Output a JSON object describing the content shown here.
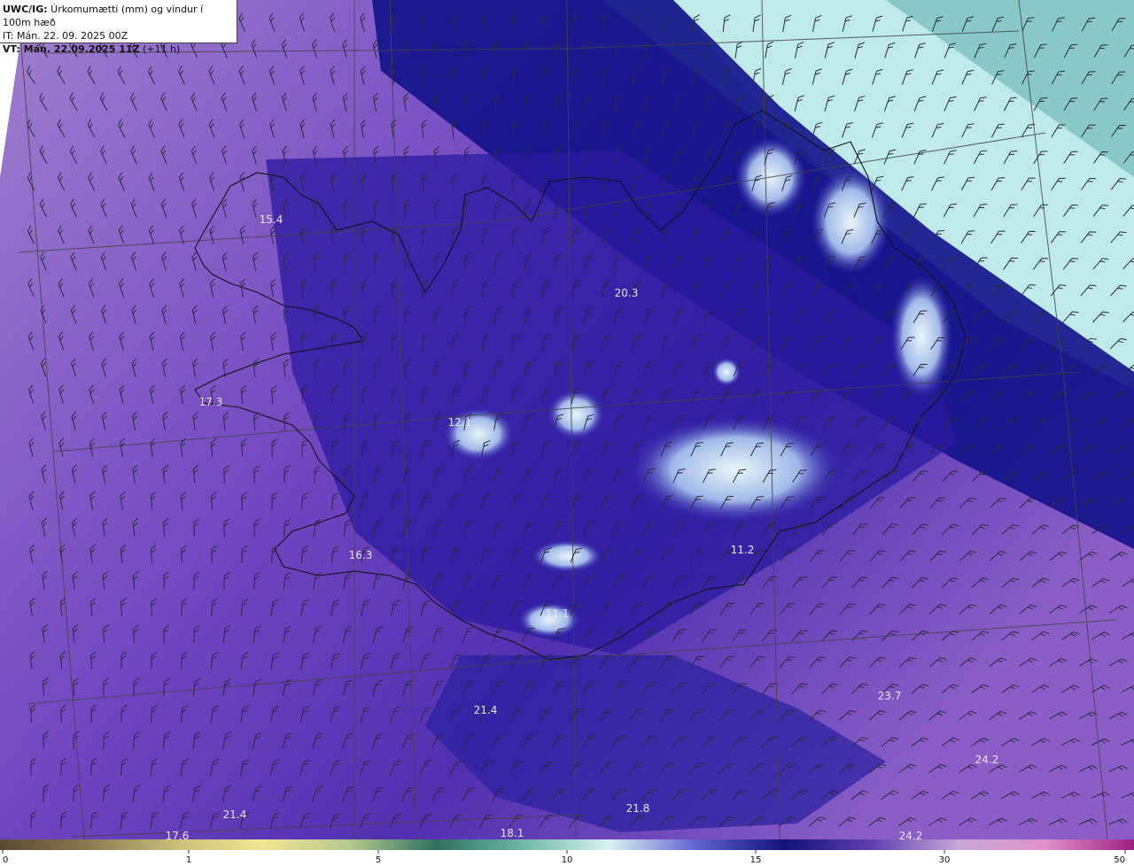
{
  "header": {
    "line1_bold": "UWC/IG:",
    "line1_rest": " Úrkomumætti (mm) og vindur í 100m hæð",
    "line2": "IT: Mán. 22. 09. 2025 00Z",
    "line3_bold": "VT: Mán. 22.09.2025 11Z",
    "line3_rest": " (+11 h)"
  },
  "map_labels": [
    {
      "text": "15.4"
    },
    {
      "text": "20.3"
    },
    {
      "text": "17.3"
    },
    {
      "text": "12.1"
    },
    {
      "text": "16.3"
    },
    {
      "text": "11.2"
    },
    {
      "text": "11.1"
    },
    {
      "text": "21.4"
    },
    {
      "text": "23.7"
    },
    {
      "text": "24.2"
    },
    {
      "text": "21.4"
    },
    {
      "text": "21.8"
    },
    {
      "text": "18.1"
    },
    {
      "text": "17.6"
    },
    {
      "text": "24.2"
    }
  ],
  "colorbar": {
    "ticks": [
      "0",
      "1",
      "5",
      "10",
      "15",
      "30",
      "50"
    ],
    "colors": [
      "#5a4a32",
      "#8a7a50",
      "#c8be78",
      "#f2e690",
      "#b4c890",
      "#2e7060",
      "#70b8a8",
      "#d8f2f2",
      "#6060d0",
      "#12127a",
      "#6040b0",
      "#c8a8d8",
      "#e090c8",
      "#a02080"
    ]
  },
  "colors": {
    "land_outline": "#111111",
    "grid": "#444444",
    "wind_barb": "#333333"
  }
}
